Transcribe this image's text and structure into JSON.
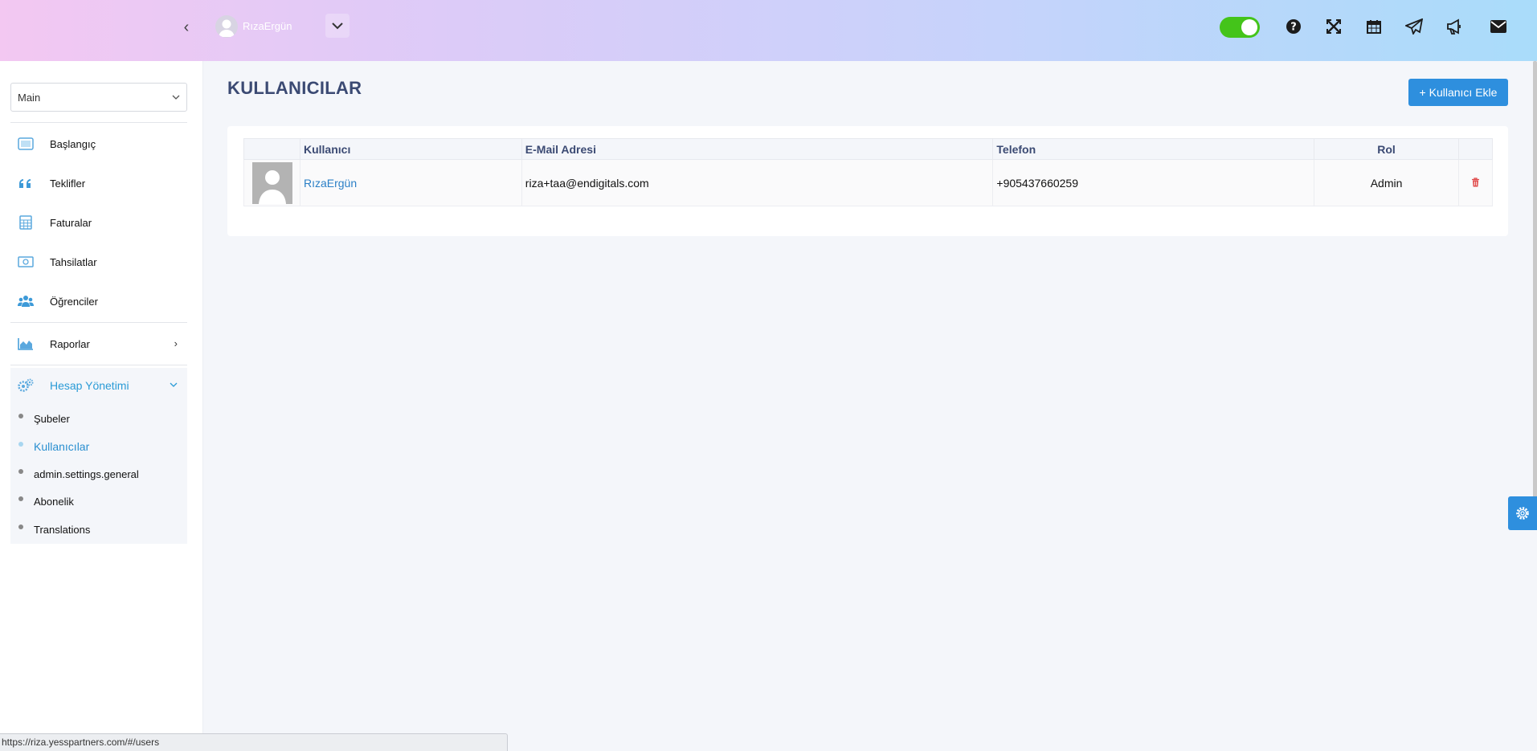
{
  "header": {
    "user_name": "RızaErgün",
    "collapse_glyph": "‹",
    "icons": [
      "help-icon",
      "fullscreen-icon",
      "calendar-icon",
      "send-icon",
      "megaphone-icon",
      "mail-icon"
    ],
    "toggle_on": true,
    "toggle_color": "#44c41a"
  },
  "sidebar": {
    "select_value": "Main",
    "items": [
      {
        "label": "Başlangıç",
        "icon": "monitor-icon"
      },
      {
        "label": "Teklifler",
        "icon": "quote-icon"
      },
      {
        "label": "Faturalar",
        "icon": "calculator-icon"
      },
      {
        "label": "Tahsilatlar",
        "icon": "money-icon"
      },
      {
        "label": "Öğrenciler",
        "icon": "users-icon"
      },
      {
        "label": "Raporlar",
        "icon": "area-chart-icon"
      },
      {
        "label": "Hesap Yönetimi",
        "icon": "cogs-icon"
      }
    ],
    "subitems": [
      {
        "label": "Şubeler"
      },
      {
        "label": "Kullanıcılar"
      },
      {
        "label": "admin.settings.general"
      },
      {
        "label": "Abonelik"
      },
      {
        "label": "Translations"
      }
    ]
  },
  "main": {
    "title": "KULLANICILAR",
    "add_button": "+ Kullanıcı Ekle",
    "table": {
      "headers": [
        "",
        "Kullanıcı",
        "E-Mail Adresi",
        "Telefon",
        "Rol",
        ""
      ],
      "rows": [
        {
          "name": "RızaErgün",
          "email": "riza+taa@endigitals.com",
          "phone": "+905437660259",
          "role": "Admin"
        }
      ]
    }
  },
  "statusbar": {
    "url": "https://riza.yesspartners.com/#/users"
  },
  "colors": {
    "accent": "#2e8fde",
    "title": "#3b4a73",
    "delete": "#e04b4b"
  }
}
